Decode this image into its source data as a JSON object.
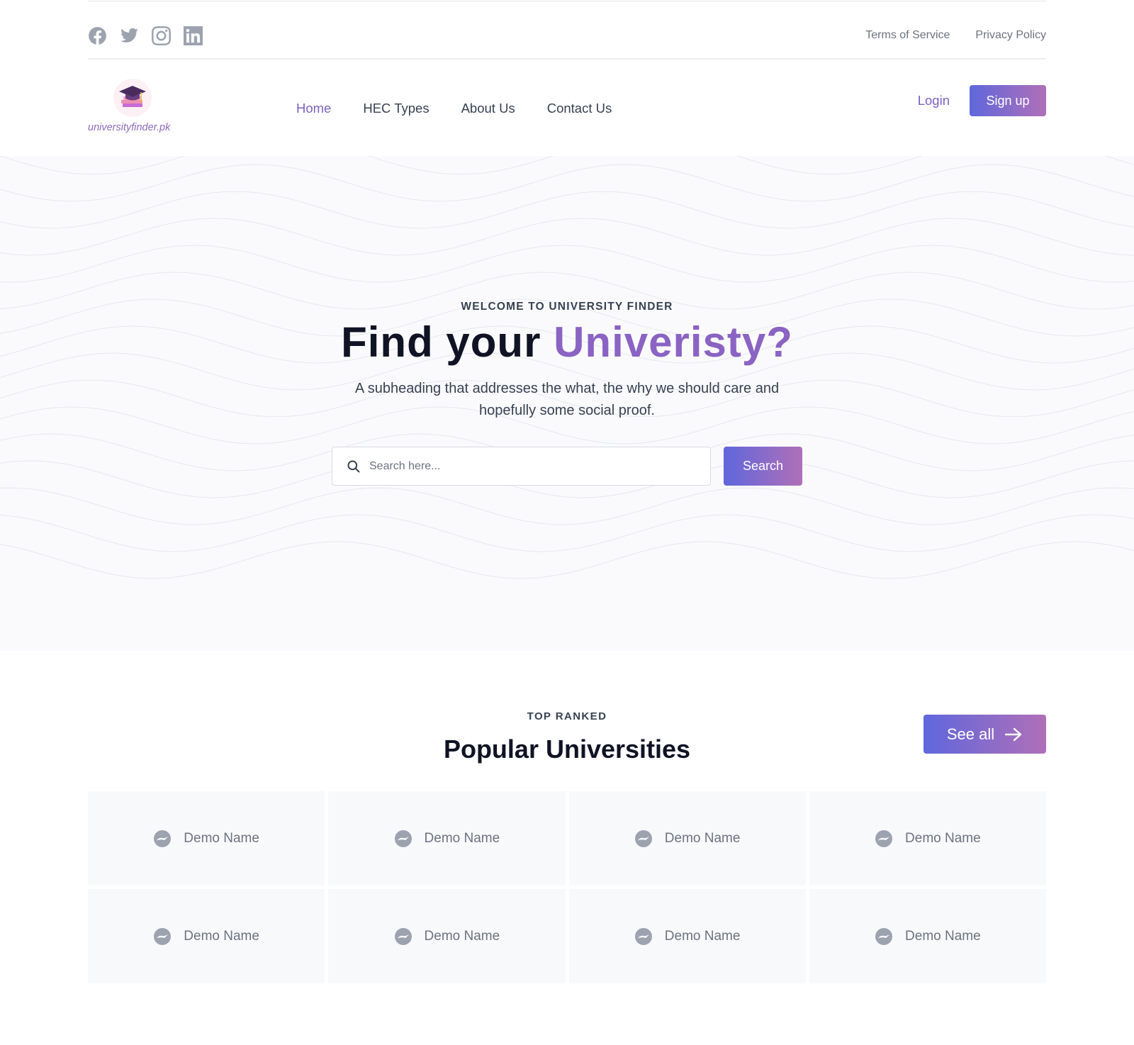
{
  "topbar": {
    "socials": [
      "facebook-icon",
      "twitter-icon",
      "instagram-icon",
      "linkedin-icon"
    ],
    "links": [
      "Terms of Service",
      "Privacy Policy"
    ]
  },
  "nav": {
    "logo_text": "universityfinder.pk",
    "items": [
      "Home",
      "HEC Types",
      "About Us",
      "Contact Us"
    ],
    "active_item": "Home",
    "login": "Login",
    "signup": "Sign up"
  },
  "hero": {
    "eyebrow": "WELCOME TO UNIVERSITY FINDER",
    "headline_plain": "Find your ",
    "headline_accent": "Univeristy?",
    "subheading": "A subheading that addresses the what, the why we should care and hopefully some social proof.",
    "search_placeholder": "Search here...",
    "search_button": "Search"
  },
  "popular": {
    "eyebrow": "TOP RANKED",
    "title": "Popular Universities",
    "see_all": "See all",
    "cards": [
      "Demo Name",
      "Demo Name",
      "Demo Name",
      "Demo Name",
      "Demo Name",
      "Demo Name",
      "Demo Name",
      "Demo Name"
    ]
  },
  "colors": {
    "accent": "#8a63c3",
    "gradient_start": "#5f67dc",
    "gradient_end": "#b06fb8",
    "icon_gray": "#9ca3af"
  }
}
